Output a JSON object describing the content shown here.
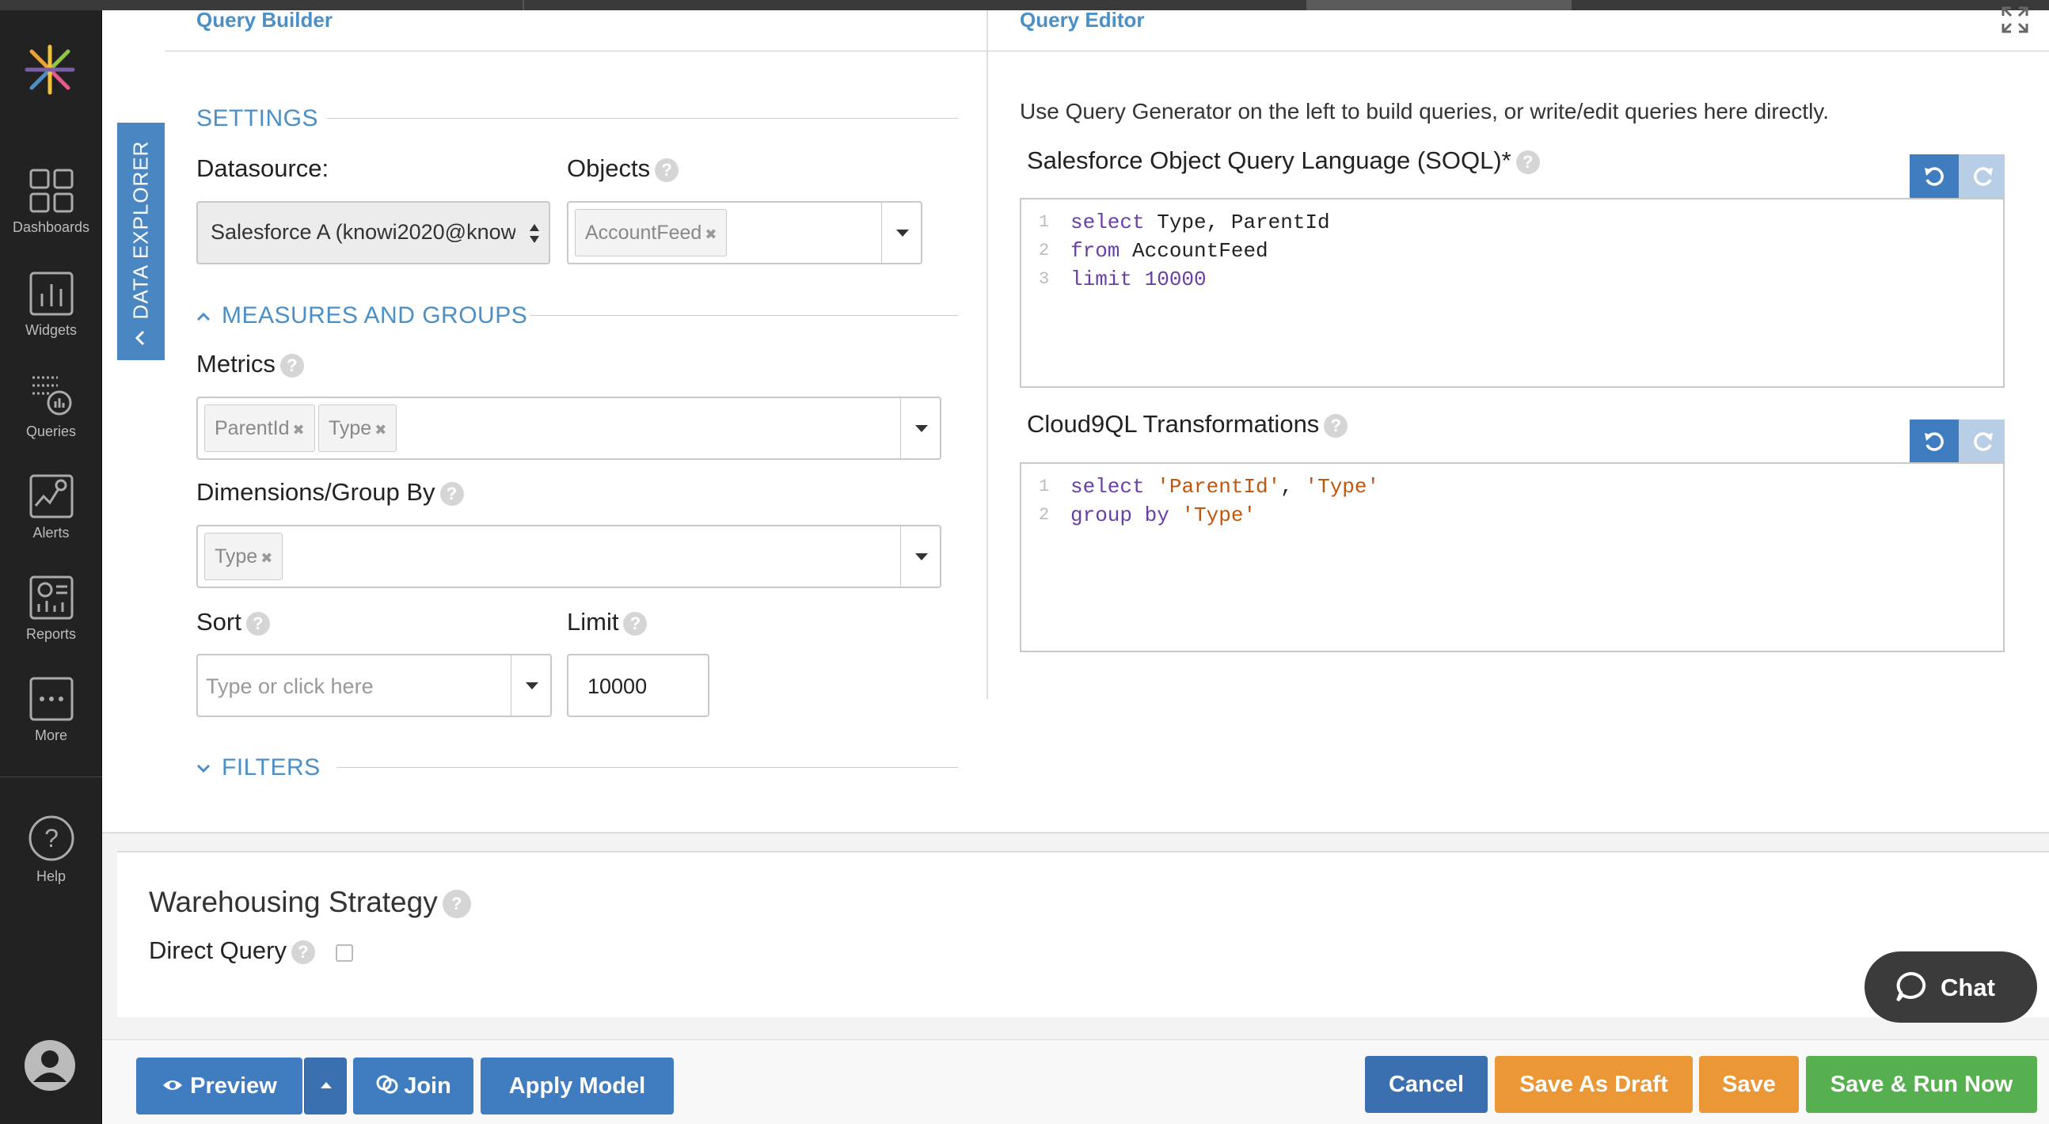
{
  "sidebar": {
    "items": [
      {
        "label": "Dashboards",
        "icon": "dashboard-grid-icon"
      },
      {
        "label": "Widgets",
        "icon": "bar-chart-icon"
      },
      {
        "label": "Queries",
        "icon": "query-icon"
      },
      {
        "label": "Alerts",
        "icon": "alert-icon"
      },
      {
        "label": "Reports",
        "icon": "report-icon"
      },
      {
        "label": "More",
        "icon": "more-icon"
      },
      {
        "label": "Help",
        "icon": "help-icon"
      }
    ]
  },
  "data_explorer_label": "DATA EXPLORER",
  "query_builder": {
    "title": "Query Builder",
    "settings_header": "SETTINGS",
    "datasource_label": "Datasource:",
    "datasource_value": "Salesforce A (knowi2020@know",
    "objects_label": "Objects",
    "objects_tags": [
      "AccountFeed"
    ],
    "measures_header": "MEASURES AND GROUPS",
    "metrics_label": "Metrics",
    "metrics_tags": [
      "ParentId",
      "Type"
    ],
    "dimensions_label": "Dimensions/Group By",
    "dimensions_tags": [
      "Type"
    ],
    "sort_label": "Sort",
    "sort_placeholder": "Type or click here",
    "limit_label": "Limit",
    "limit_value": "10000",
    "filters_header": "FILTERS"
  },
  "query_editor": {
    "title": "Query Editor",
    "hint": "Use Query Generator on the left to build queries, or write/edit queries here directly.",
    "soql_label": "Salesforce Object Query Language (SOQL)*",
    "soql_lines": [
      {
        "n": "1",
        "kw": "select",
        "rest": " Type, ParentId"
      },
      {
        "n": "2",
        "kw": "from",
        "rest": " AccountFeed"
      },
      {
        "n": "3",
        "kw": "limit",
        "rest": " 10000"
      }
    ],
    "c9ql_label": "Cloud9QL Transformations",
    "c9ql_lines": [
      {
        "n": "1",
        "kw": "select",
        "rest_a": "'ParentId'",
        "sep": ", ",
        "rest_b": "'Type'"
      },
      {
        "n": "2",
        "kw": "group by",
        "rest_a": "'Type'",
        "sep": "",
        "rest_b": ""
      }
    ]
  },
  "warehousing": {
    "title": "Warehousing Strategy",
    "direct_query_label": "Direct Query"
  },
  "buttons": {
    "preview": "Preview",
    "join": "Join",
    "apply_model": "Apply Model",
    "cancel": "Cancel",
    "save_as_draft": "Save As Draft",
    "save": "Save",
    "save_run": "Save & Run Now"
  },
  "chat_label": "Chat",
  "colors": {
    "accent": "#4b8fc7",
    "primary_button": "#3f7cc0",
    "warning_button": "#eb9735",
    "success_button": "#56b04f",
    "sidebar_bg": "#222222"
  }
}
